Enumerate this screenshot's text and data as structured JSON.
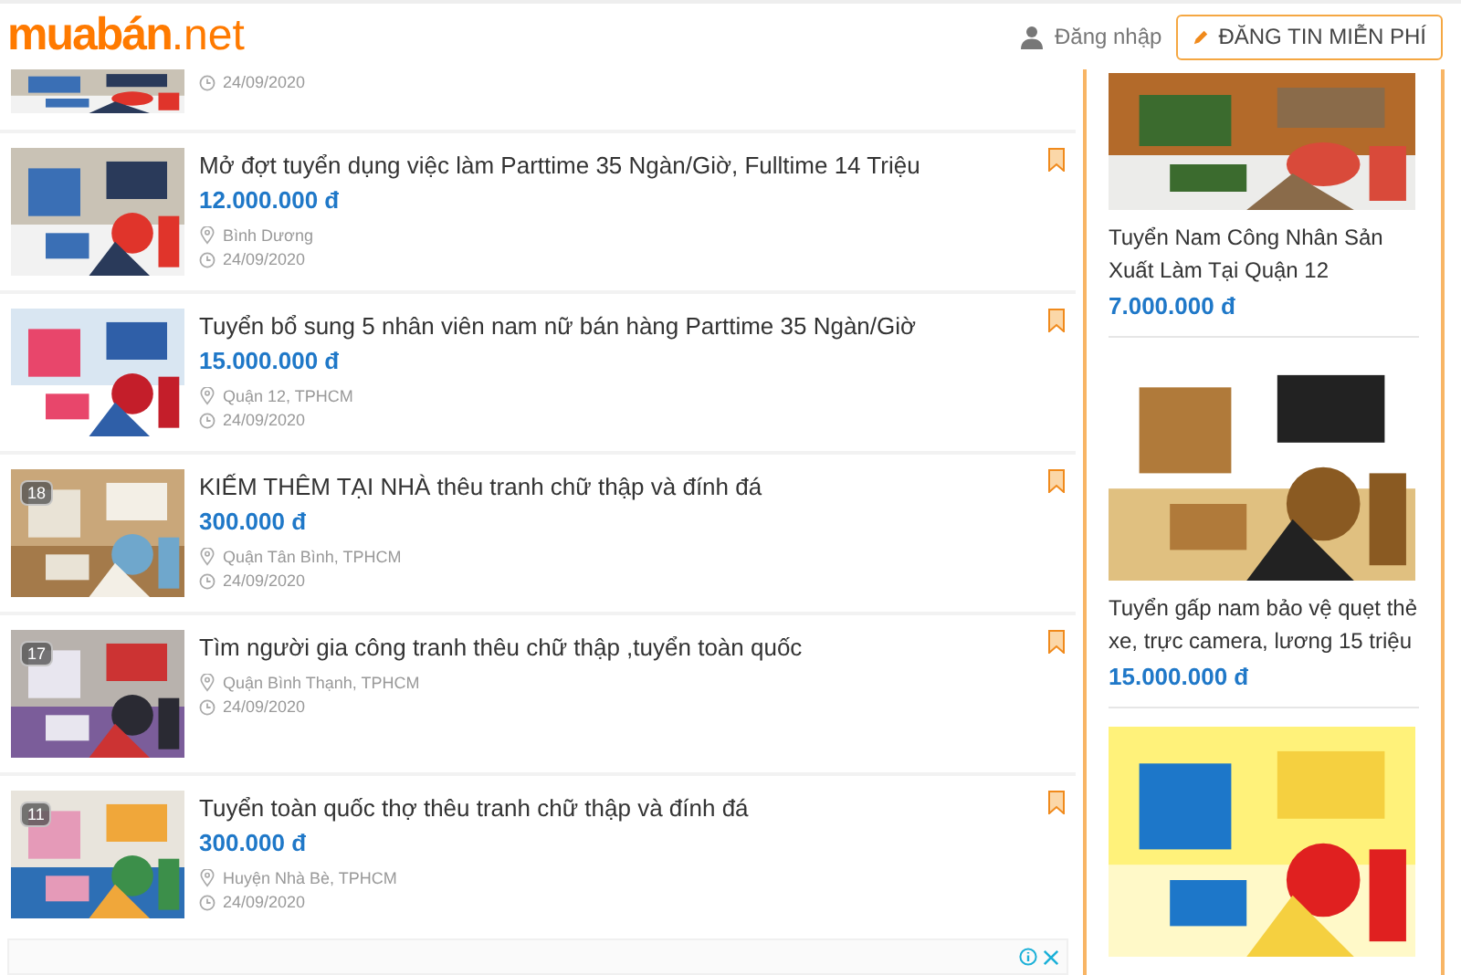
{
  "header": {
    "logo": {
      "brand": "muabán",
      "suffix": ".net"
    },
    "login": "Đăng nhập",
    "post_button": "ĐĂNG TIN MIỄN PHÍ"
  },
  "partial_listing": {
    "date": "24/09/2020"
  },
  "listings": [
    {
      "title": "Mở đợt tuyển dụng việc làm Parttime 35 Ngàn/Giờ, Fulltime 14 Triệu",
      "price": "12.000.000 đ",
      "location": "Bình Dương",
      "date": "24/09/2020"
    },
    {
      "title": "Tuyển bổ sung 5 nhân viên nam nữ bán hàng Parttime 35 Ngàn/Giờ",
      "price": "15.000.000 đ",
      "location": "Quận 12, TPHCM",
      "date": "24/09/2020"
    },
    {
      "title": "KIẾM THÊM TẠI NHÀ thêu tranh chữ thập và đính đá",
      "price": "300.000 đ",
      "location": "Quận Tân Bình, TPHCM",
      "date": "24/09/2020",
      "photo_count": "18"
    },
    {
      "title": "Tìm người gia công tranh thêu chữ thập ,tuyển toàn quốc",
      "location": "Quận Bình Thạnh, TPHCM",
      "date": "24/09/2020",
      "photo_count": "17"
    },
    {
      "title": "Tuyển toàn quốc thợ thêu tranh chữ thập và đính đá",
      "price": "300.000 đ",
      "location": "Huyện Nhà Bè, TPHCM",
      "date": "24/09/2020",
      "photo_count": "11"
    }
  ],
  "sidebar": [
    {
      "kind": "job",
      "title": "Tuyển Nam Công Nhân Sản Xuất Làm Tại Quận 12",
      "price": "7.000.000 đ"
    },
    {
      "kind": "job",
      "title": "Tuyển gấp nam bảo vệ quẹt thẻ xe, trực camera, lương 15 triệu",
      "price": "15.000.000 đ"
    },
    {
      "kind": "banner"
    }
  ]
}
